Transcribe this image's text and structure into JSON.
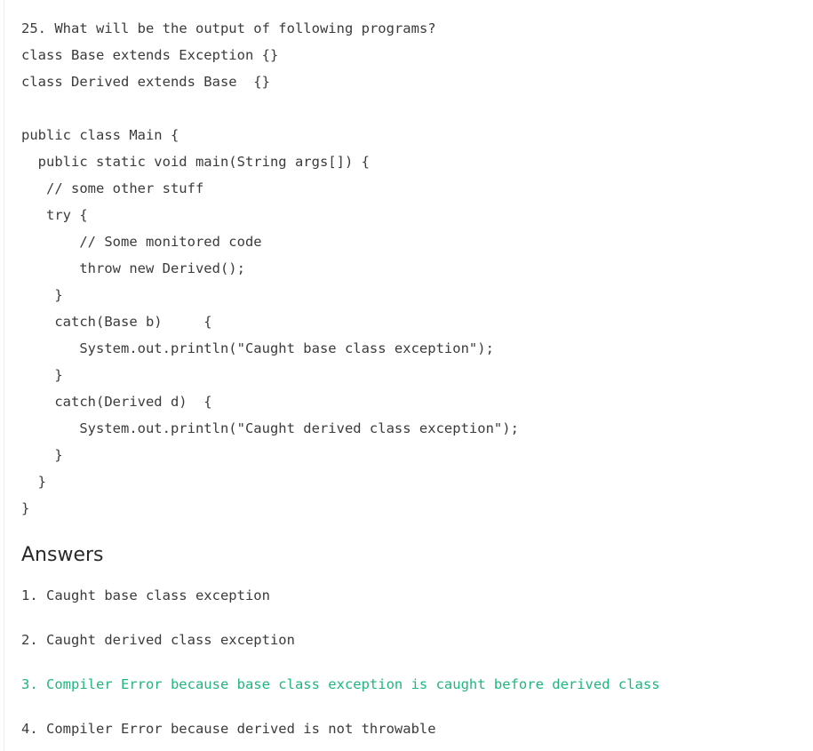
{
  "question": {
    "number": "25.",
    "text": "What will be the output of following programs?"
  },
  "code": [
    "class Base extends Exception {}",
    "class Derived extends Base  {}",
    "",
    "public class Main {",
    "  public static void main(String args[]) {",
    "   // some other stuff",
    "   try {",
    "       // Some monitored code",
    "       throw new Derived();",
    "    }",
    "    catch(Base b)     {",
    "       System.out.println(\"Caught base class exception\");",
    "    }",
    "    catch(Derived d)  {",
    "       System.out.println(\"Caught derived class exception\");",
    "    }",
    "  }",
    "}"
  ],
  "answers_heading": "Answers",
  "answers": [
    {
      "label": "1. Caught base class exception"
    },
    {
      "label": "2. Caught derived class exception"
    },
    {
      "label": "3. Compiler Error because base class exception is caught before derived class"
    },
    {
      "label": "4. Compiler Error because derived is not throwable"
    }
  ],
  "colors": {
    "text": "#3b3b3b",
    "correct": "#1fb67e"
  }
}
